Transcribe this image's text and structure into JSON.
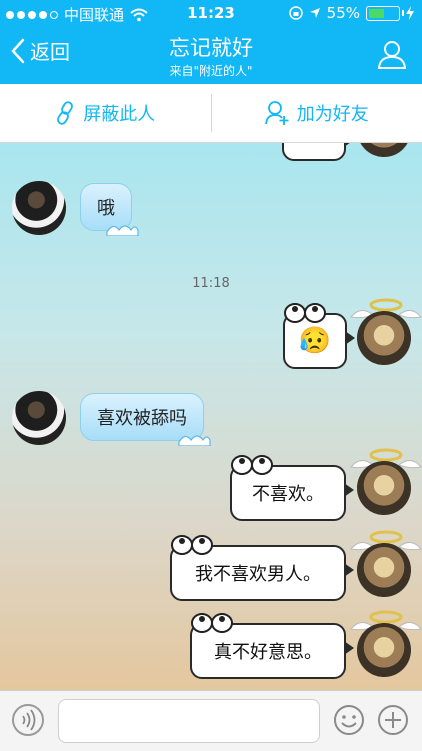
{
  "status": {
    "carrier": "中国联通",
    "time": "11:23",
    "battery": "55%",
    "battery_level": 0.55
  },
  "nav": {
    "back_label": "返回",
    "title": "忘记就好",
    "subtitle": "来自\"附近的人\""
  },
  "actions": {
    "block_label": "屏蔽此人",
    "add_friend_label": "加为好友"
  },
  "messages": {
    "m1": "哦",
    "timestamp": "11:18",
    "m2_emoji": "😥",
    "m3": "喜欢被舔吗",
    "m4": "不喜欢。",
    "m5": "我不喜欢男人。",
    "m6": "真不好意思。"
  },
  "icons": {
    "back": "chevron-left-icon",
    "profile": "person-outline-icon",
    "block": "broken-link-icon",
    "add_friend": "add-person-icon",
    "voice": "voice-icon",
    "emoji": "smiley-icon",
    "plus": "plus-icon"
  },
  "colors": {
    "accent": "#12b7f5"
  }
}
